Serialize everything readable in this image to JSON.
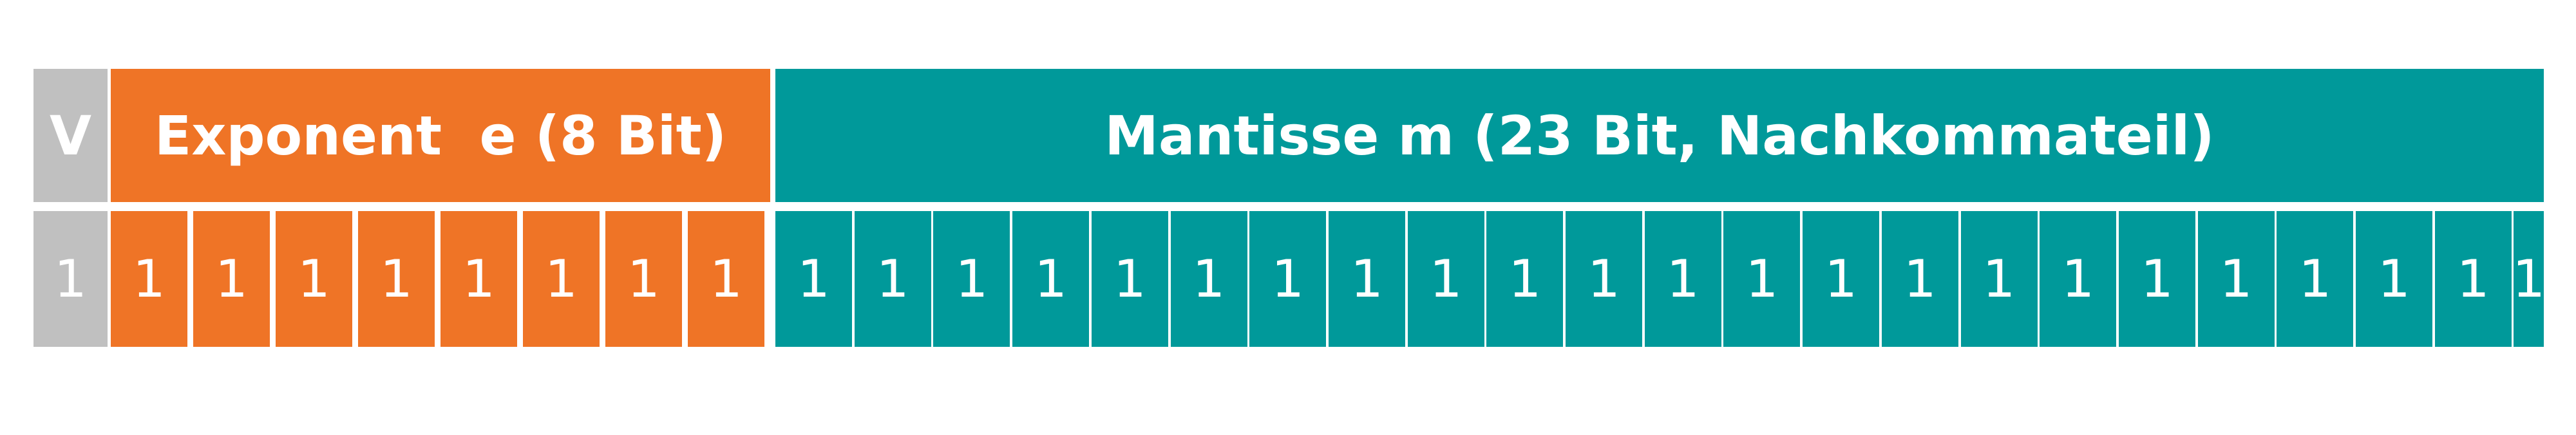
{
  "header": {
    "sign_label": "V",
    "exponent_label": "Exponent  e (8 Bit)",
    "mantissa_label": "Mantisse m (23 Bit, Nachkommateil)"
  },
  "bits": {
    "sign": [
      "1"
    ],
    "exponent": [
      "1",
      "1",
      "1",
      "1",
      "1",
      "1",
      "1",
      "1"
    ],
    "mantissa": [
      "1",
      "1",
      "1",
      "1",
      "1",
      "1",
      "1",
      "1",
      "1",
      "1",
      "1",
      "1",
      "1",
      "1",
      "1",
      "1",
      "1",
      "1",
      "1",
      "1",
      "1",
      "1",
      "1"
    ]
  },
  "colors": {
    "sign": "#c0c0c0",
    "exponent": "#ef7426",
    "mantissa": "#00999a",
    "text": "#ffffff"
  }
}
